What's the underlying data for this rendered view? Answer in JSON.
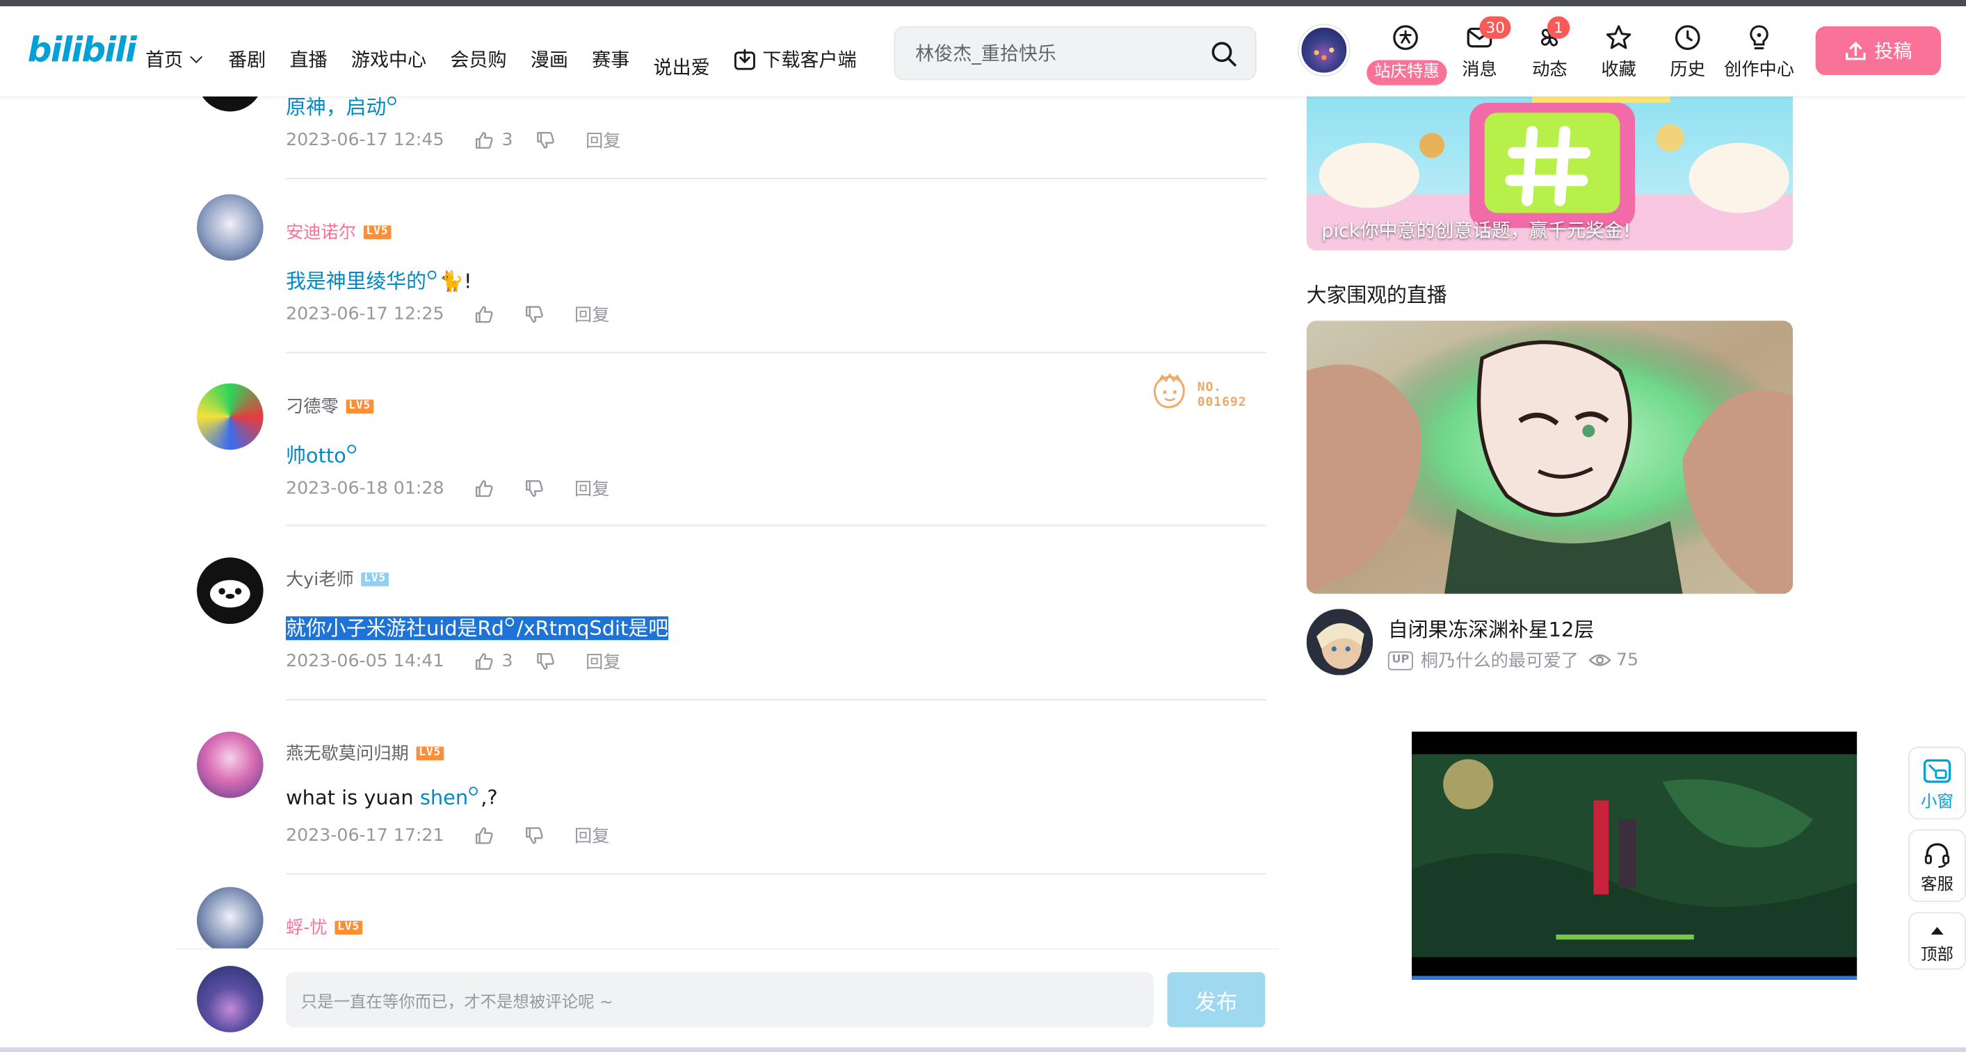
{
  "header": {
    "logo_text": "bilibili",
    "nav": [
      "首页",
      "番剧",
      "直播",
      "游戏中心",
      "会员购",
      "漫画",
      "赛事",
      "说出爱"
    ],
    "download_label": "下载客户端",
    "search_placeholder": "林俊杰_重拾快乐",
    "promo_label": "站庆特惠",
    "icons": [
      {
        "label": "消息",
        "badge": "30",
        "icon": "mail-icon"
      },
      {
        "label": "动态",
        "badge": "1",
        "icon": "pinwheel-icon"
      },
      {
        "label": "收藏",
        "icon": "star-icon"
      },
      {
        "label": "历史",
        "icon": "clock-icon"
      },
      {
        "label": "创作中心",
        "icon": "lightbulb-icon"
      }
    ],
    "upload_label": "投稿",
    "accent_pink": "#fb7299",
    "accent_blue": "#00a1d6"
  },
  "comments": [
    {
      "name": "",
      "text": "原神，启动",
      "date": "2023-06-17 12:45",
      "likes": "3",
      "reply": "回复"
    },
    {
      "name": "安迪诺尔",
      "level": "LV5",
      "text": "我是神里绫华的",
      "text_suffix": "!",
      "date": "2023-06-17 12:25",
      "likes": "",
      "reply": "回复"
    },
    {
      "name": "刁德零",
      "level": "LV5",
      "text": "帅otto",
      "date": "2023-06-18 01:28",
      "likes": "",
      "reply": "回复",
      "medal": {
        "line1": "NO.",
        "line2": "001692"
      }
    },
    {
      "name": "大yi老师",
      "level": "LV5",
      "text_a": "就你小子米游社uid是Rd",
      "text_b": "/xRtmqSdit是吧",
      "date": "2023-06-05 14:41",
      "likes": "3",
      "reply": "回复"
    },
    {
      "name": "燕无歇莫问归期",
      "level": "LV5",
      "text_plain": "what is yuan ",
      "text_link": "shen",
      "text_tail": ",?",
      "date": "2023-06-17 17:21",
      "likes": "",
      "reply": "回复"
    },
    {
      "name": "蜉-忧",
      "level": "LV5"
    }
  ],
  "reply_bar": {
    "placeholder": "只是一直在等你而已，才不是想被评论呢 ~",
    "send_label": "发布"
  },
  "sidebar": {
    "banner_caption": "pick你中意的创意话题，赢千元奖金!",
    "live_section_title": "大家围观的直播",
    "live_title": "自闭果冻深渊补星12层",
    "live_up_tag": "UP",
    "live_uploader": "桐乃什么的最可爱了",
    "live_views": "75"
  },
  "side_buttons": [
    "小窗",
    "客服",
    "顶部"
  ]
}
